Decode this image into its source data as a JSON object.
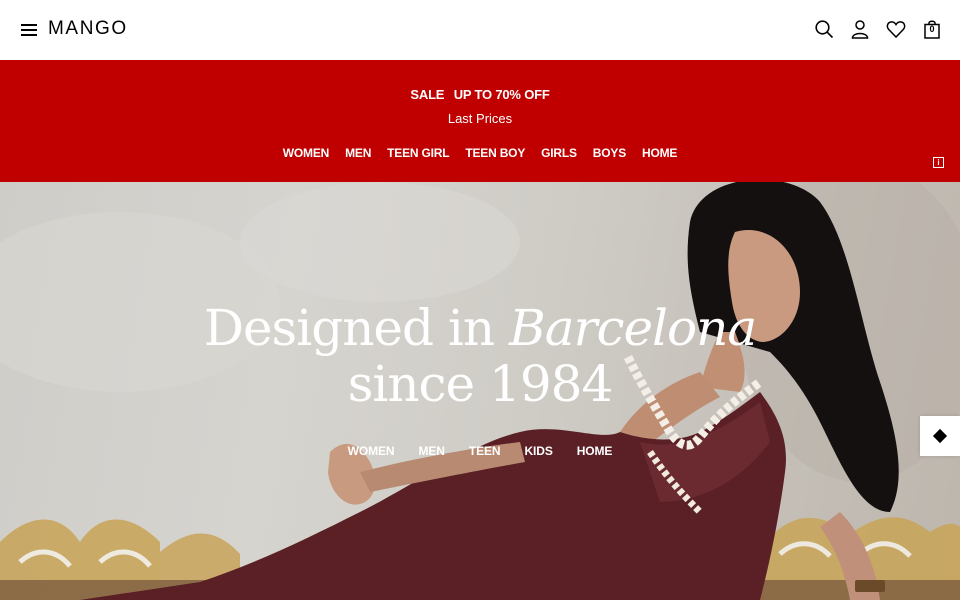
{
  "header": {
    "logo": "MANGO",
    "bag_count": "0",
    "icons": [
      "menu-icon",
      "search-icon",
      "user-icon",
      "heart-icon",
      "bag-icon"
    ]
  },
  "promo": {
    "sale": "SALE",
    "offer": "UP TO 70% OFF",
    "subtitle": "Last Prices",
    "nav": [
      "WOMEN",
      "MEN",
      "TEEN GIRL",
      "TEEN BOY",
      "GIRLS",
      "BOYS",
      "HOME"
    ],
    "info": "i",
    "color": "#c00000"
  },
  "hero": {
    "title_line1_a": "Designed in ",
    "title_line1_b": "Barcelona",
    "title_line2": "since 1984",
    "nav": [
      "WOMEN",
      "MEN",
      "TEEN",
      "KIDS",
      "HOME"
    ]
  }
}
